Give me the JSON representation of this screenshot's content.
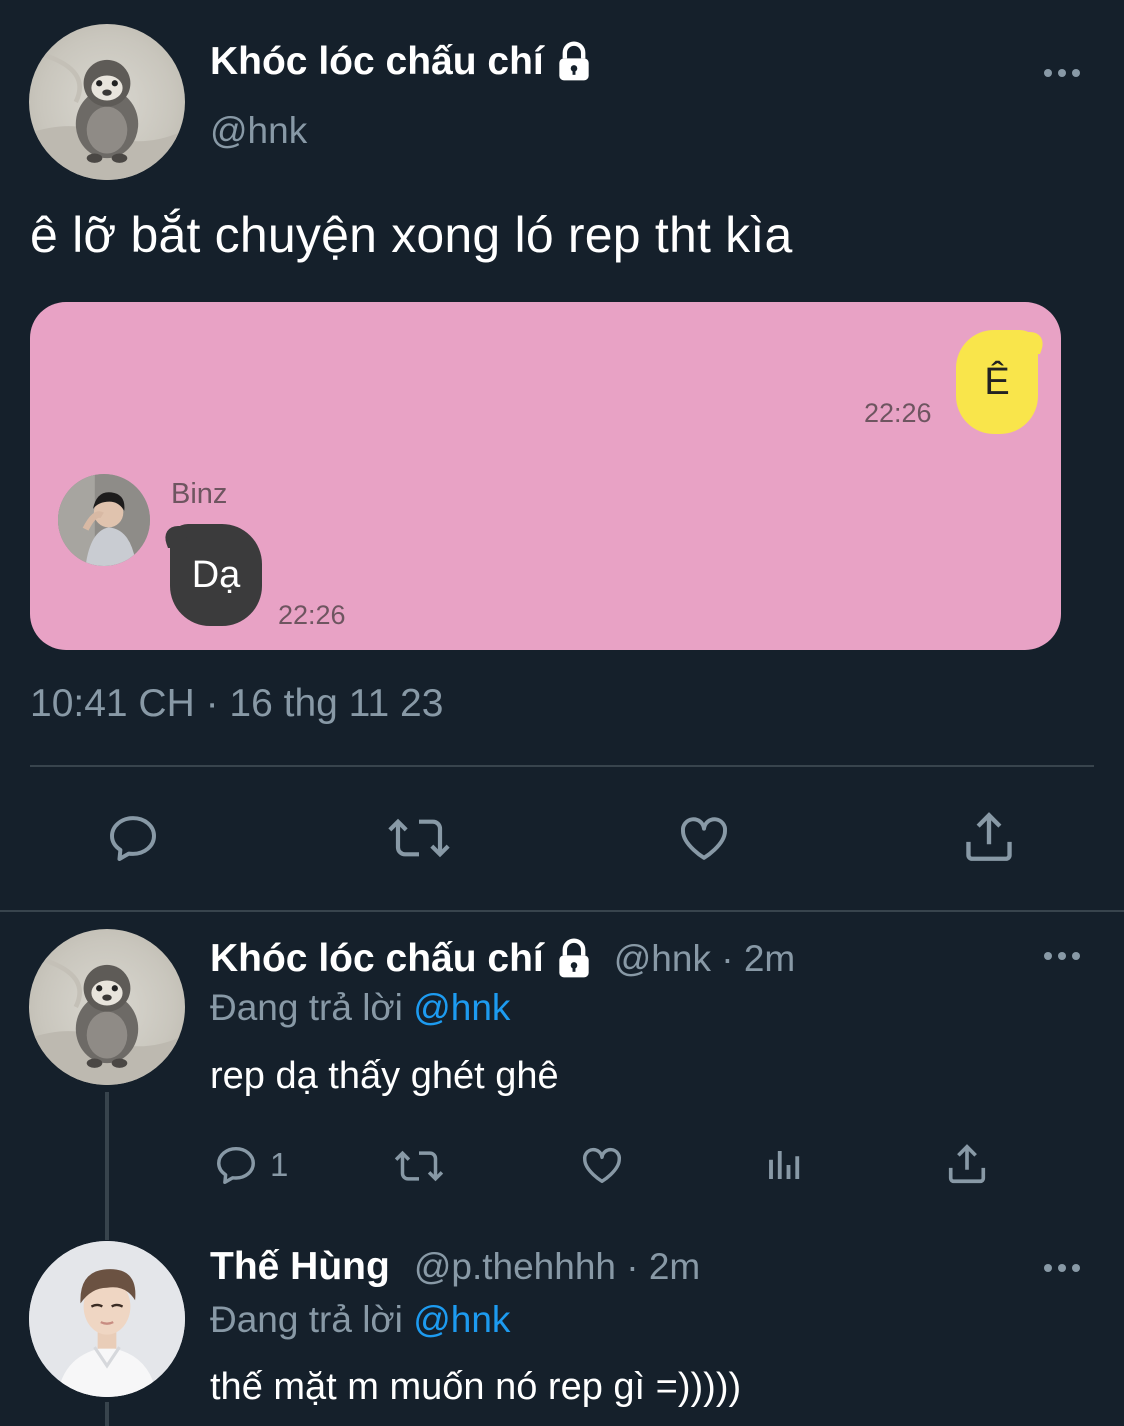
{
  "tweet": {
    "display_name": "Khóc lóc chấu chí",
    "handle": "@hnk",
    "text": "ê lỡ bắt chuyện xong ló rep tht kìa",
    "timestamp": "10:41 CH · 16 thg 11 23",
    "media": {
      "outgoing_message": "Ê",
      "outgoing_time": "22:26",
      "contact_name": "Binz",
      "incoming_message": "Dạ",
      "incoming_time": "22:26",
      "background_color": "#e8a2c5",
      "outgoing_bubble_color": "#f9e54b",
      "incoming_bubble_color": "#3b3b3c"
    }
  },
  "replies": [
    {
      "display_name": "Khóc lóc chấu chí",
      "meta": "@hnk · 2m",
      "replying_prefix": "Đang trả lời",
      "replying_to": "@hnk",
      "text": "rep dạ thấy ghét ghê",
      "reply_count": "1"
    },
    {
      "display_name": "Thế Hùng",
      "meta": "@p.thehhhh · 2m",
      "replying_prefix": "Đang trả lời",
      "replying_to": "@hnk",
      "text": "thế mặt m muốn nó rep gì =)))))"
    }
  ],
  "icons": {
    "lock": "lock-icon",
    "more": "more-icon",
    "reply": "reply-icon",
    "retweet": "retweet-icon",
    "like": "heart-icon",
    "share": "share-icon",
    "views": "views-icon"
  },
  "colors": {
    "background": "#15202b",
    "secondary_text": "#8899a6",
    "mention": "#1d9bf0",
    "divider": "#38444d"
  }
}
